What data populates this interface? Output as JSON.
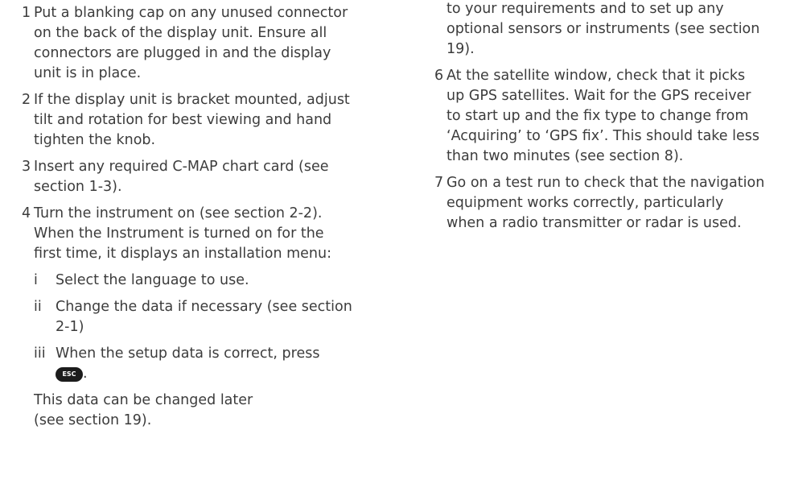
{
  "left_column": {
    "step1": {
      "number": "1",
      "lines": [
        "Put a blanking cap on any unused connector",
        "on the back of the display unit. Ensure all",
        "connectors are plugged in and the display",
        "unit is in place."
      ]
    },
    "step2": {
      "number": "2",
      "lines": [
        "If the display unit is bracket mounted, adjust",
        "tilt and rotation for best viewing and hand",
        "tighten the knob."
      ]
    },
    "step3": {
      "number": "3",
      "lines": [
        "Insert any required C-MAP chart card (see",
        "section 1-3)."
      ]
    },
    "step4": {
      "number": "4",
      "lines": [
        "Turn the instrument on (see section 2-2).",
        "When the Instrument is turned on for the",
        "first time, it displays an installation menu:"
      ],
      "sub_i": {
        "numeral": "i",
        "lines": [
          "Select the language to use."
        ]
      },
      "sub_ii": {
        "numeral": "ii",
        "lines": [
          "Change the data if necessary (see section",
          "2-1)"
        ]
      },
      "sub_iii": {
        "numeral": "iii",
        "lines": [
          "When the setup data is correct, press"
        ],
        "key_label": "ESC",
        "trailing": "."
      },
      "note_lines": [
        "This data can be changed later",
        "(see section 19)."
      ]
    }
  },
  "right_column": {
    "step5_continued": {
      "lines": [
        "to your requirements and to set up any",
        "optional sensors or instruments (see section",
        "19)."
      ]
    },
    "step6": {
      "number": "6",
      "lines": [
        "At the satellite window, check that it picks",
        "up GPS satellites. Wait for the GPS receiver",
        "to start up and the fix type to change from",
        "‘Acquiring’ to ‘GPS fix’. This should take less",
        "than two minutes (see section 8)."
      ]
    },
    "step7": {
      "number": "7",
      "lines": [
        "Go on a test run to check that the navigation",
        "equipment works correctly, particularly",
        "when a radio transmitter or radar is used."
      ]
    }
  }
}
